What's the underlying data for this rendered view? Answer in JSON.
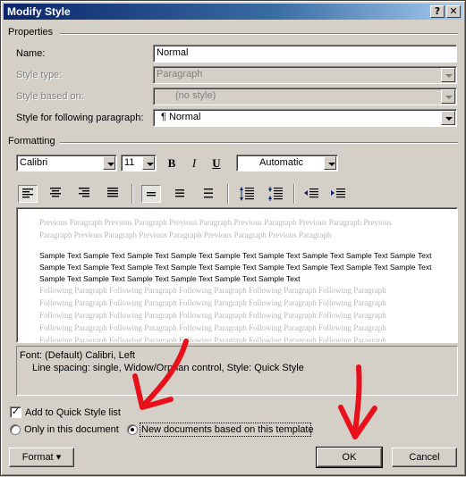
{
  "window": {
    "title": "Modify Style",
    "help_glyph": "?",
    "close_glyph": "✕"
  },
  "properties": {
    "header": "Properties",
    "name_label": "Name:",
    "name_value": "Normal",
    "style_type_label": "Style type:",
    "style_type_value": "Paragraph",
    "based_on_label": "Style based on:",
    "based_on_value": "(no style)",
    "following_label": "Style for following paragraph:",
    "following_value": "¶ Normal"
  },
  "formatting": {
    "header": "Formatting",
    "font": "Calibri",
    "size": "11",
    "bold": "B",
    "italic": "I",
    "underline": "U",
    "color": "Automatic",
    "icons": [
      "align-left-icon",
      "align-center-icon",
      "align-right-icon",
      "justify-icon",
      "single-spacing-icon",
      "one-half-spacing-icon",
      "double-spacing-icon",
      "increase-para-spacing-icon",
      "decrease-para-spacing-icon",
      "decrease-indent-icon",
      "increase-indent-icon"
    ]
  },
  "preview": {
    "previous_lines": [
      "Previous Paragraph Previous Paragraph Previous Paragraph Previous Paragraph Previous Paragraph Previous",
      "Paragraph Previous Paragraph Previous Paragraph Previous Paragraph Previous Paragraph"
    ],
    "sample_lines": [
      "Sample Text Sample Text Sample Text Sample Text Sample Text Sample Text Sample Text Sample Text Sample Text",
      "Sample Text Sample Text Sample Text Sample Text Sample Text Sample Text Sample Text Sample Text Sample Text",
      "Sample Text Sample Text Sample Text Sample Text Sample Text Sample Text"
    ],
    "following_lines": [
      "Following Paragraph Following Paragraph Following Paragraph Following Paragraph Following Paragraph",
      "Following Paragraph Following Paragraph Following Paragraph Following Paragraph Following Paragraph",
      "Following Paragraph Following Paragraph Following Paragraph Following Paragraph Following Paragraph",
      "Following Paragraph Following Paragraph Following Paragraph Following Paragraph Following Paragraph",
      "Following Paragraph Following Paragraph Following Paragraph Following Paragraph Following Paragraph"
    ]
  },
  "description": {
    "line1": "Font: (Default) Calibri, Left",
    "line2": "Line spacing:  single, Widow/Orphan control, Style: Quick Style"
  },
  "options": {
    "add_quick_style": "Add to Quick Style list",
    "add_quick_style_checked": true,
    "only_this_doc": "Only in this document",
    "new_docs_template": "New documents based on this template",
    "selected": "new_docs_template"
  },
  "buttons": {
    "format": "Format",
    "format_arrow": "▾",
    "ok": "OK",
    "cancel": "Cancel"
  },
  "annotation_color": "#e8101a"
}
